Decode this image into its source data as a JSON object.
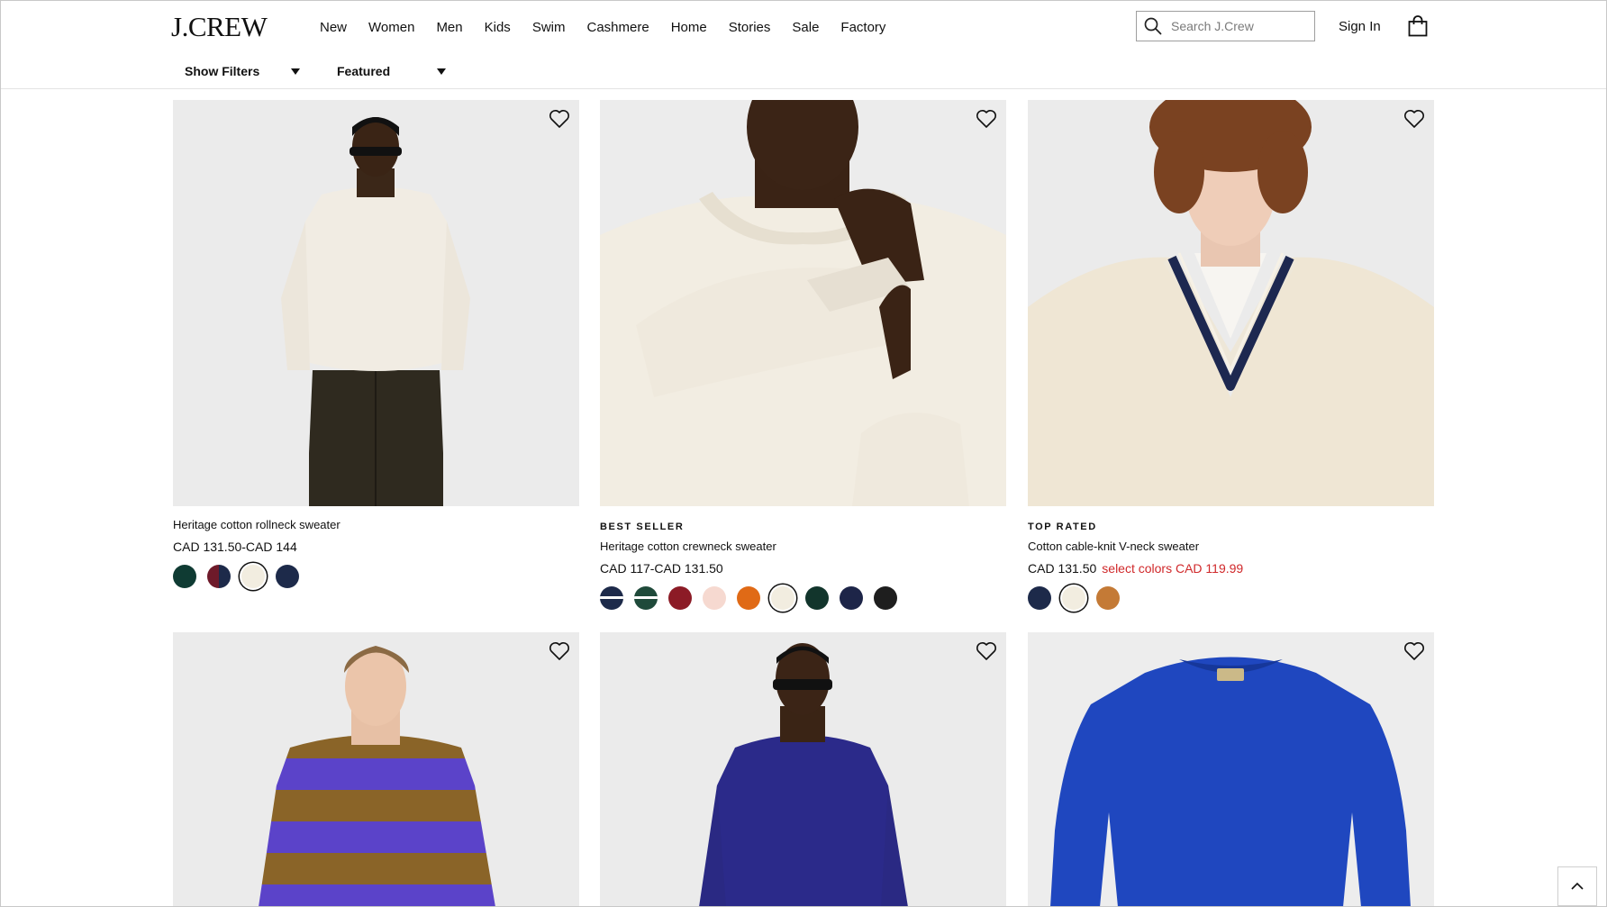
{
  "brand": {
    "logo_text": "J.CREW"
  },
  "nav": [
    "New",
    "Women",
    "Men",
    "Kids",
    "Swim",
    "Cashmere",
    "Home",
    "Stories",
    "Sale",
    "Factory"
  ],
  "search": {
    "placeholder": "Search J.Crew",
    "value": ""
  },
  "account": {
    "sign_in": "Sign In"
  },
  "filters": {
    "show_filters": "Show Filters",
    "sort": "Featured"
  },
  "colors": {
    "sale_red": "#d0282a",
    "text": "#111111"
  },
  "products": [
    {
      "badge": "",
      "name": "Heritage cotton rollneck sweater",
      "price": "CAD 131.50-CAD 144",
      "sale_text": "",
      "image": "model in cream rollneck sweater and dark corduroy pants",
      "swatches": [
        "#0f3b33",
        "#6e1a2a",
        "#f2ede0",
        "#1d2a4a"
      ],
      "selected_swatch": 2
    },
    {
      "badge": "BEST SELLER",
      "name": "Heritage cotton crewneck sweater",
      "price": "CAD 117-CAD 131.50",
      "sale_text": "",
      "image": "close-up of cream crewneck sweater cuff",
      "swatches": [
        "#1d2a4a",
        "#1f4a3a",
        "#8c1b26",
        "#f6d9d0",
        "#e06a16",
        "#f2ede0",
        "#12352c",
        "#1d2548",
        "#1e1e1e"
      ],
      "selected_swatch": 5
    },
    {
      "badge": "TOP RATED",
      "name": "Cotton cable-knit V-neck sweater",
      "price": "CAD 131.50",
      "sale_text": "select colors CAD 119.99",
      "image": "model in cream cable-knit V-neck sweater with navy trim",
      "swatches": [
        "#1d2a4a",
        "#f2ede0",
        "#c47a36"
      ],
      "selected_swatch": 1
    },
    {
      "badge": "",
      "name": "",
      "price": "",
      "sale_text": "",
      "image": "model in purple and brown striped sweater",
      "swatches": [],
      "selected_swatch": -1
    },
    {
      "badge": "",
      "name": "",
      "price": "",
      "sale_text": "",
      "image": "model in indigo ribbed crewneck sweater",
      "swatches": [],
      "selected_swatch": -1
    },
    {
      "badge": "",
      "name": "",
      "price": "",
      "sale_text": "",
      "image": "royal blue crewneck sweater flat lay",
      "swatches": [],
      "selected_swatch": -1
    }
  ]
}
